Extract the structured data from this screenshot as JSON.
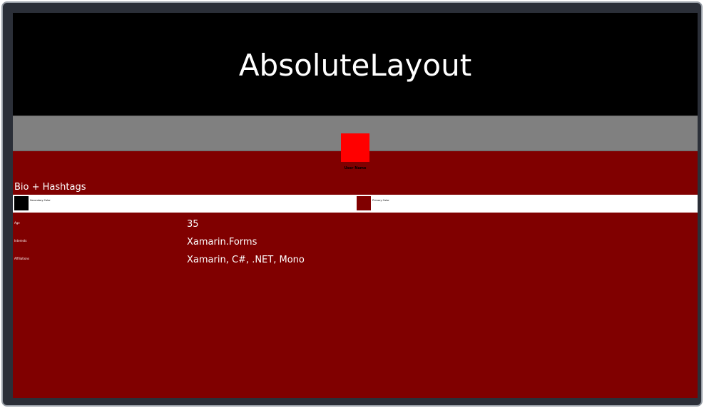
{
  "header": {
    "title": "AbsoluteLayout"
  },
  "profile": {
    "user_name": "User Name"
  },
  "bio": {
    "section_title": "Bio + Hashtags"
  },
  "colors": {
    "secondary_label": "Secondary Color",
    "secondary_value": "#000000",
    "primary_label": "Primary Color",
    "primary_value": "#800000",
    "page_background": "#800000",
    "header_background": "#000000",
    "band_background": "#808080",
    "avatar_color": "#ff0000"
  },
  "fields": [
    {
      "label": "Age",
      "value": "35"
    },
    {
      "label": "Interests",
      "value": "Xamarin.Forms"
    },
    {
      "label": "Affiliations",
      "value": "Xamarin, C#, .NET, Mono"
    }
  ]
}
